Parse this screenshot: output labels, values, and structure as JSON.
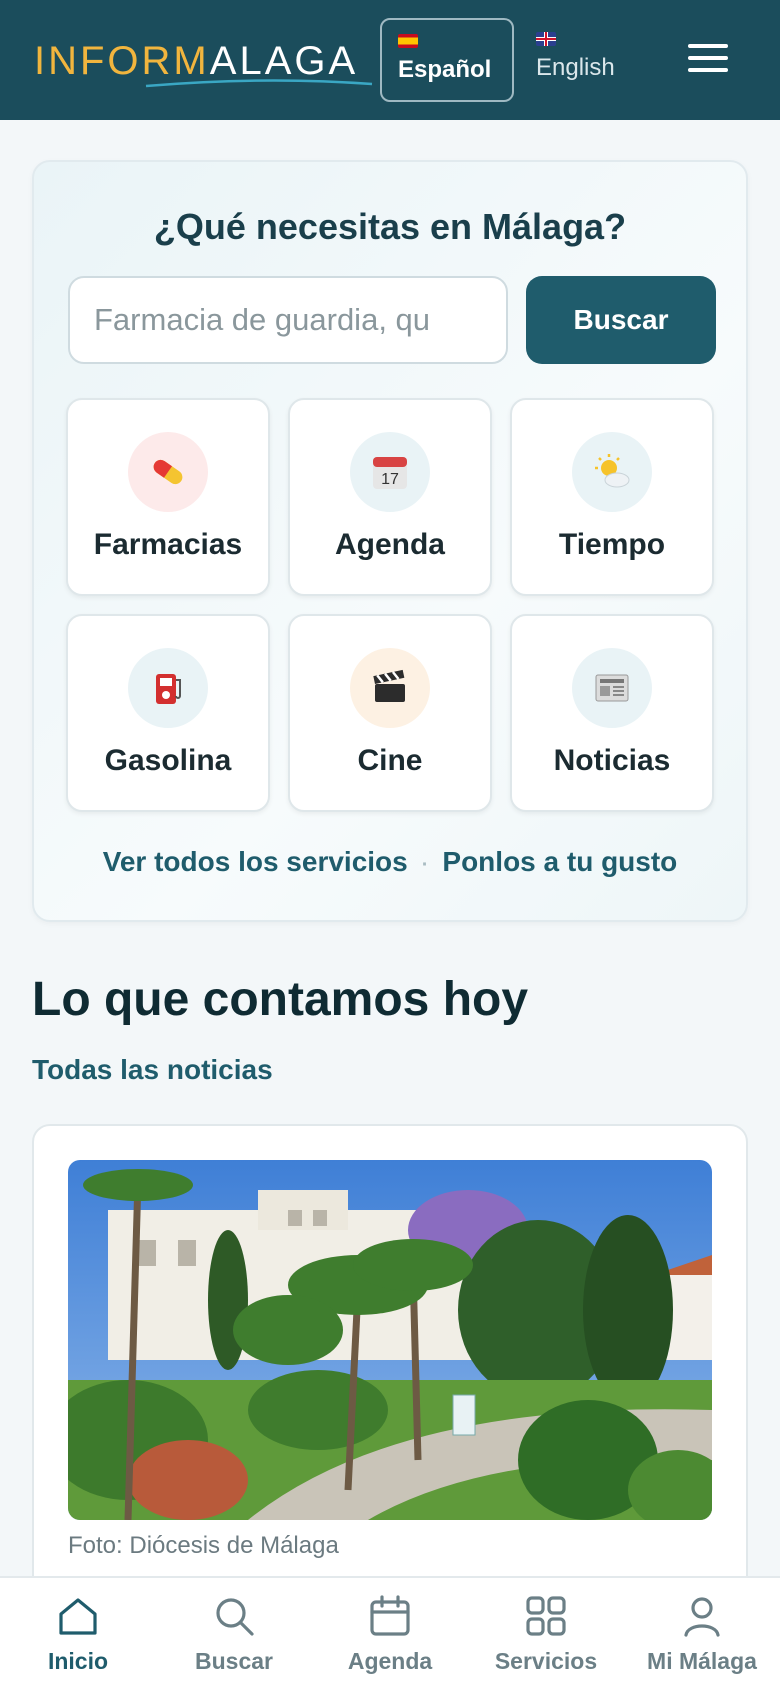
{
  "header": {
    "logo_part1": "INFORM",
    "logo_part2": "ALAGA",
    "languages": [
      {
        "label": "Español",
        "active": true
      },
      {
        "label": "English",
        "active": false
      }
    ]
  },
  "search": {
    "title": "¿Qué necesitas en Málaga?",
    "placeholder": "Farmacia de guardia, qu",
    "button_label": "Buscar"
  },
  "services": [
    {
      "label": "Farmacias",
      "icon": "pill-icon"
    },
    {
      "label": "Agenda",
      "icon": "calendar-icon"
    },
    {
      "label": "Tiempo",
      "icon": "sun-cloud-icon"
    },
    {
      "label": "Gasolina",
      "icon": "fuel-pump-icon"
    },
    {
      "label": "Cine",
      "icon": "clapperboard-icon"
    },
    {
      "label": "Noticias",
      "icon": "newspaper-icon"
    }
  ],
  "links": {
    "all_services": "Ver todos los servicios",
    "separator": "·",
    "customize": "Ponlos a tu gusto"
  },
  "news": {
    "section_title": "Lo que contamos hoy",
    "all_news": "Todas las noticias",
    "photo_caption": "Foto: Diócesis de Málaga"
  },
  "bottom_nav": [
    {
      "label": "Inicio",
      "icon": "home-icon",
      "active": true
    },
    {
      "label": "Buscar",
      "icon": "search-icon",
      "active": false
    },
    {
      "label": "Agenda",
      "icon": "calendar-icon",
      "active": false
    },
    {
      "label": "Servicios",
      "icon": "grid-icon",
      "active": false
    },
    {
      "label": "Mi Málaga",
      "icon": "user-icon",
      "active": false
    }
  ],
  "colors": {
    "header_bg": "#1b4d5c",
    "accent": "#1f5c6c",
    "logo_yellow": "#f1b53e"
  }
}
